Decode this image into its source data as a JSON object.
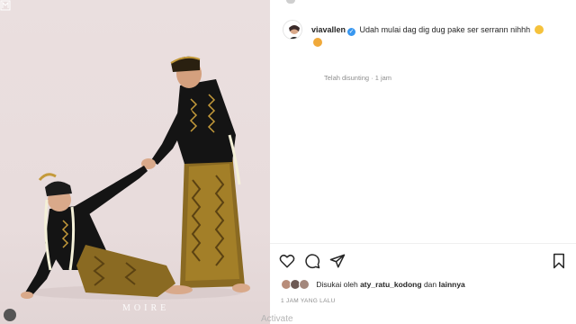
{
  "post": {
    "username": "viavallen",
    "verified_mark": "✓",
    "caption": "Udah mulai dag dig dug pake ser serrann nihhh",
    "edited_label": "Telah disunting · 1 jam",
    "watermark": "MOIRE",
    "liked_by_prefix": "Disukai oleh",
    "liked_by_user": "aty_ratu_kodong",
    "liked_by_connector": "dan",
    "liked_by_others": "lainnya",
    "time_label": "1 JAM YANG LALU"
  },
  "actions": {
    "icons": [
      "heart-icon",
      "comment-icon",
      "share-icon",
      "bookmark-icon"
    ]
  },
  "system": {
    "activate_text": "Activate"
  },
  "colors": {
    "accent_verified": "#3897f0",
    "text_primary": "#262626",
    "text_secondary": "#8e8e8e",
    "photo_background": "#eadfdf"
  }
}
